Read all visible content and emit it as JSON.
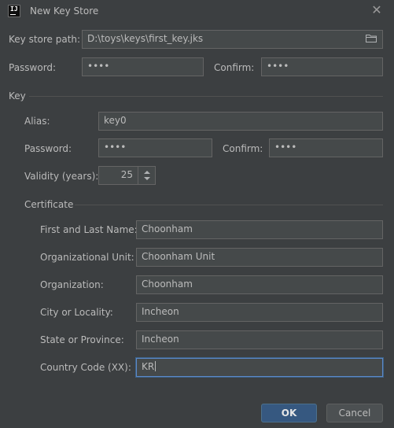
{
  "window": {
    "title": "New Key Store",
    "app_icon_text": "IJ"
  },
  "keystore": {
    "path_label": "Key store path:",
    "path_value": "D:\\toys\\keys\\first_key.jks",
    "password_label": "Password:",
    "password_value": "••••",
    "confirm_label": "Confirm:",
    "confirm_value": "••••"
  },
  "key": {
    "section_label": "Key",
    "alias_label": "Alias:",
    "alias_value": "key0",
    "password_label": "Password:",
    "password_value": "••••",
    "confirm_label": "Confirm:",
    "confirm_value": "••••",
    "validity_label": "Validity (years):",
    "validity_value": "25"
  },
  "certificate": {
    "section_label": "Certificate",
    "fields": [
      {
        "label": "First and Last Name:",
        "value": "Choonham"
      },
      {
        "label": "Organizational Unit:",
        "value": "Choonham Unit"
      },
      {
        "label": "Organization:",
        "value": "Choonham"
      },
      {
        "label": "City or Locality:",
        "value": "Incheon"
      },
      {
        "label": "State or Province:",
        "value": "Incheon"
      },
      {
        "label": "Country Code (XX):",
        "value": "KR"
      }
    ]
  },
  "buttons": {
    "ok_label": "OK",
    "cancel_label": "Cancel"
  },
  "icons": {
    "app": "intellij-icon",
    "close": "close-icon",
    "browse": "folder-icon",
    "spinner": "spinner-arrows-icon"
  },
  "colors": {
    "background": "#3c3f41",
    "field_bg": "#45494a",
    "field_border": "#646464",
    "focus_border": "#5c89c9",
    "ok_button": "#365880"
  }
}
